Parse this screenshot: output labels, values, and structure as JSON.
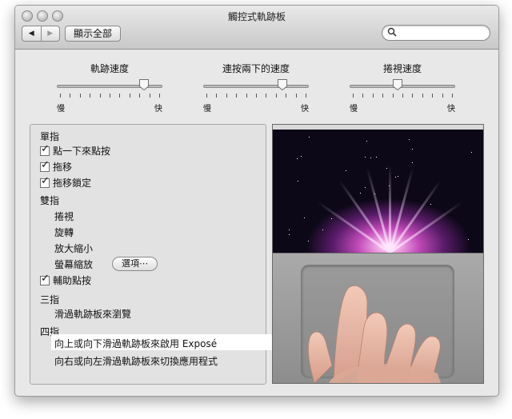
{
  "window": {
    "title": "觸控式軌跡板"
  },
  "toolbar": {
    "back_label": "◀",
    "forward_label": "▶",
    "show_all_label": "顯示全部",
    "search_value": "",
    "search_placeholder": ""
  },
  "sliders": [
    {
      "label": "軌跡速度",
      "min_label": "慢",
      "max_label": "快",
      "value": 0.85
    },
    {
      "label": "連按兩下的速度",
      "min_label": "慢",
      "max_label": "快",
      "value": 0.77
    },
    {
      "label": "捲視速度",
      "min_label": "慢",
      "max_label": "快",
      "value": 0.45
    }
  ],
  "one_finger": {
    "header": "單指",
    "tap_to_click": {
      "label": "點一下來點按",
      "checked": true
    },
    "dragging": {
      "label": "拖移",
      "checked": true
    },
    "drag_lock": {
      "label": "拖移鎖定",
      "checked": true
    }
  },
  "two_fingers": {
    "header": "雙指",
    "scroll": "捲視",
    "rotate": "旋轉",
    "zoom": "放大縮小",
    "screen_zoom": "螢幕縮放",
    "options_button": "選項⋯",
    "secondary_click": {
      "label": "輔助點按",
      "checked": true
    }
  },
  "three_fingers": {
    "header": "三指",
    "swipe": "滑過軌跡板來瀏覽"
  },
  "four_fingers": {
    "header": "四指",
    "expose": "向上或向下滑過軌跡板來啟用 Exposé",
    "switch_apps": "向右或向左滑過軌跡板來切換應用程式"
  },
  "icons": {
    "close": "close-button-icon",
    "minimize": "minimize-button-icon",
    "zoom": "zoom-button-icon",
    "search": "magnifier-icon",
    "check": "✓"
  }
}
